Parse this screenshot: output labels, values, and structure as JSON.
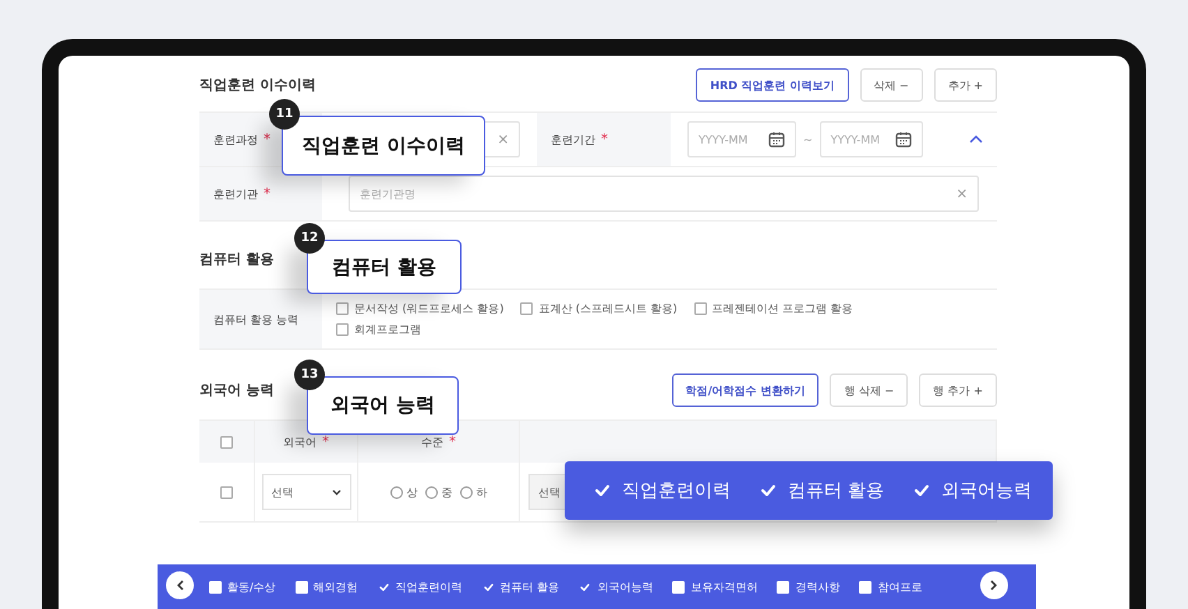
{
  "training": {
    "title": "직업훈련 이수이력",
    "buttons": [
      {
        "label": "HRD 직업훈련 이력보기",
        "kind": "primary"
      },
      {
        "label": "삭제 −",
        "kind": "plain"
      },
      {
        "label": "추가 +",
        "kind": "plain"
      }
    ],
    "course": {
      "label": "훈련과정",
      "required": "*",
      "clear": "×"
    },
    "period": {
      "label": "훈련기간",
      "required": "*",
      "from": {
        "placeholder": "YYYY-MM"
      },
      "separator": "~",
      "to": {
        "placeholder": "YYYY-MM"
      }
    },
    "institution": {
      "label": "훈련기관",
      "required": "*",
      "placeholder": "훈련기관명",
      "clear": "×"
    }
  },
  "computer": {
    "title": "컴퓨터 활용",
    "label": "컴퓨터 활용 능력",
    "options": [
      {
        "label": "문서작성 (워드프로세스 활용)",
        "checked": false
      },
      {
        "label": "표계산 (스프레드시트 활용)",
        "checked": false
      },
      {
        "label": "프레젠테이션 프로그램 활용",
        "checked": false
      },
      {
        "label": "회계프로그램",
        "checked": false
      }
    ]
  },
  "language": {
    "title": "외국어 능력",
    "buttons": [
      {
        "label": "학점/어학점수 변환하기",
        "kind": "primary"
      },
      {
        "label": "행 삭제 −",
        "kind": "plain"
      },
      {
        "label": "행 추가 +",
        "kind": "plain"
      }
    ],
    "select_all": {
      "checked": false
    },
    "columns": [
      {
        "label": "외국어",
        "required": "*"
      },
      {
        "label": "수준",
        "required": "*"
      }
    ],
    "rows": [
      {
        "checked": false,
        "language": "선택",
        "levels": [
          {
            "label": "상",
            "selected": false
          },
          {
            "label": "중",
            "selected": false
          },
          {
            "label": "하",
            "selected": false
          }
        ],
        "test": "선택"
      }
    ]
  },
  "callouts": [
    {
      "number": "11",
      "label": "직업훈련 이수이력"
    },
    {
      "number": "12",
      "label": "컴퓨터 활용"
    },
    {
      "number": "13",
      "label": "외국어 능력"
    }
  ],
  "highlight": [
    {
      "label": "직업훈련이력",
      "checked": true
    },
    {
      "label": "컴퓨터 활용",
      "checked": true
    },
    {
      "label": "외국어능력",
      "checked": true
    }
  ],
  "bottom_bar": [
    {
      "label": "활동/수상",
      "checked": false
    },
    {
      "label": "해외경험",
      "checked": false
    },
    {
      "label": "직업훈련이력",
      "checked": true
    },
    {
      "label": "컴퓨터 활용",
      "checked": true
    },
    {
      "label": "외국어능력",
      "checked": true
    },
    {
      "label": "보유자격면허",
      "checked": false
    },
    {
      "label": "경력사항",
      "checked": false
    },
    {
      "label": "참여프로",
      "checked": false
    }
  ]
}
